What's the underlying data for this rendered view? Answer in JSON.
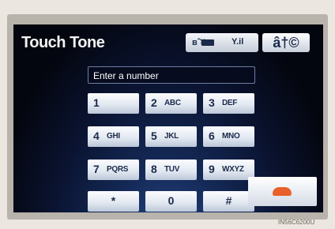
{
  "header": {
    "title": "Touch Tone"
  },
  "status": {
    "bluetooth": "вˆ¥",
    "signal": "Y.il",
    "icons": [
      "bluetooth-icon",
      "battery-icon",
      "signal-icon"
    ]
  },
  "back": {
    "label": "â†©"
  },
  "entry": {
    "placeholder": "Enter a number"
  },
  "keypad": {
    "keys": [
      {
        "digit": "1",
        "letters": ""
      },
      {
        "digit": "2",
        "letters": "ABC"
      },
      {
        "digit": "3",
        "letters": "DEF"
      },
      {
        "digit": "4",
        "letters": "GHI"
      },
      {
        "digit": "5",
        "letters": "JKL"
      },
      {
        "digit": "6",
        "letters": "MNO"
      },
      {
        "digit": "7",
        "letters": "PQRS"
      },
      {
        "digit": "8",
        "letters": "TUV"
      },
      {
        "digit": "9",
        "letters": "WXYZ"
      },
      {
        "digit": "*",
        "letters": ""
      },
      {
        "digit": "0",
        "letters": ""
      },
      {
        "digit": "#",
        "letters": ""
      }
    ]
  },
  "end_call": {
    "icon": "end-call-icon",
    "color": "#e8602a"
  },
  "image_code": "IN56C6200U"
}
